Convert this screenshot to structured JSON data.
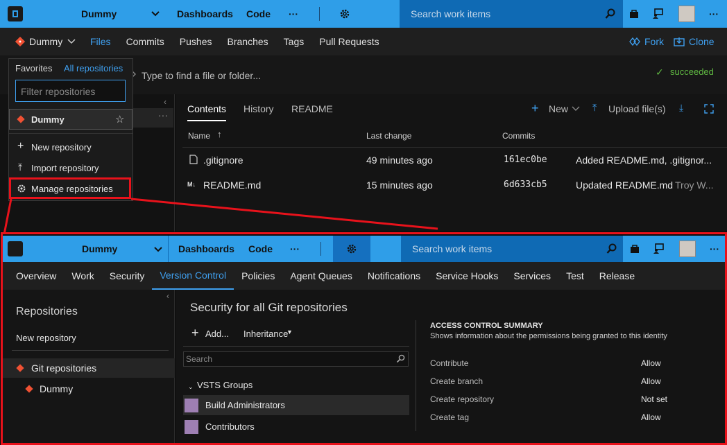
{
  "top": {
    "project": "Dummy",
    "nav": [
      "Dashboards",
      "Code"
    ],
    "more": "···",
    "search_placeholder": "Search work items"
  },
  "code_nav": {
    "repo": "Dummy",
    "tabs": [
      "Files",
      "Commits",
      "Pushes",
      "Branches",
      "Tags",
      "Pull Requests"
    ],
    "fork": "Fork",
    "clone": "Clone"
  },
  "path_bar": {
    "placeholder": "Type to find a file or folder...",
    "status": "succeeded"
  },
  "repo_dropdown": {
    "tabs": [
      "Favorites",
      "All repositories"
    ],
    "filter_placeholder": "Filter repositories",
    "repo": "Dummy",
    "actions": [
      "New repository",
      "Import repository",
      "Manage repositories"
    ]
  },
  "files_panel": {
    "tabs": [
      "Contents",
      "History",
      "README"
    ],
    "new_label": "New",
    "upload_label": "Upload file(s)",
    "columns": [
      "Name",
      "Last change",
      "Commits"
    ],
    "rows": [
      {
        "name": ".gitignore",
        "change": "49 minutes ago",
        "commit": "161ec0be",
        "message": "Added README.md, .gitignor..."
      },
      {
        "name": "README.md",
        "change": "15 minutes ago",
        "commit": "6d633cb5",
        "message": "Updated README.md",
        "author": "Troy W..."
      }
    ]
  },
  "admin": {
    "project": "Dummy",
    "nav": [
      "Dashboards",
      "Code"
    ],
    "search_placeholder": "Search work items",
    "tabs": [
      "Overview",
      "Work",
      "Security",
      "Version Control",
      "Policies",
      "Agent Queues",
      "Notifications",
      "Service Hooks",
      "Services",
      "Test",
      "Release"
    ],
    "sidebar": {
      "title": "Repositories",
      "new_repo": "New repository",
      "git_repos": "Git repositories",
      "repo": "Dummy"
    },
    "security": {
      "title": "Security for all Git repositories",
      "add": "Add...",
      "inheritance": "Inheritance",
      "search_placeholder": "Search",
      "group_header": "VSTS Groups",
      "groups": [
        "Build Administrators",
        "Contributors"
      ]
    },
    "acs": {
      "title": "ACCESS CONTROL SUMMARY",
      "subtitle": "Shows information about the permissions being granted to this identity",
      "rows": [
        {
          "perm": "Contribute",
          "value": "Allow"
        },
        {
          "perm": "Create branch",
          "value": "Allow"
        },
        {
          "perm": "Create repository",
          "value": "Not set"
        },
        {
          "perm": "Create tag",
          "value": "Allow"
        }
      ]
    }
  }
}
